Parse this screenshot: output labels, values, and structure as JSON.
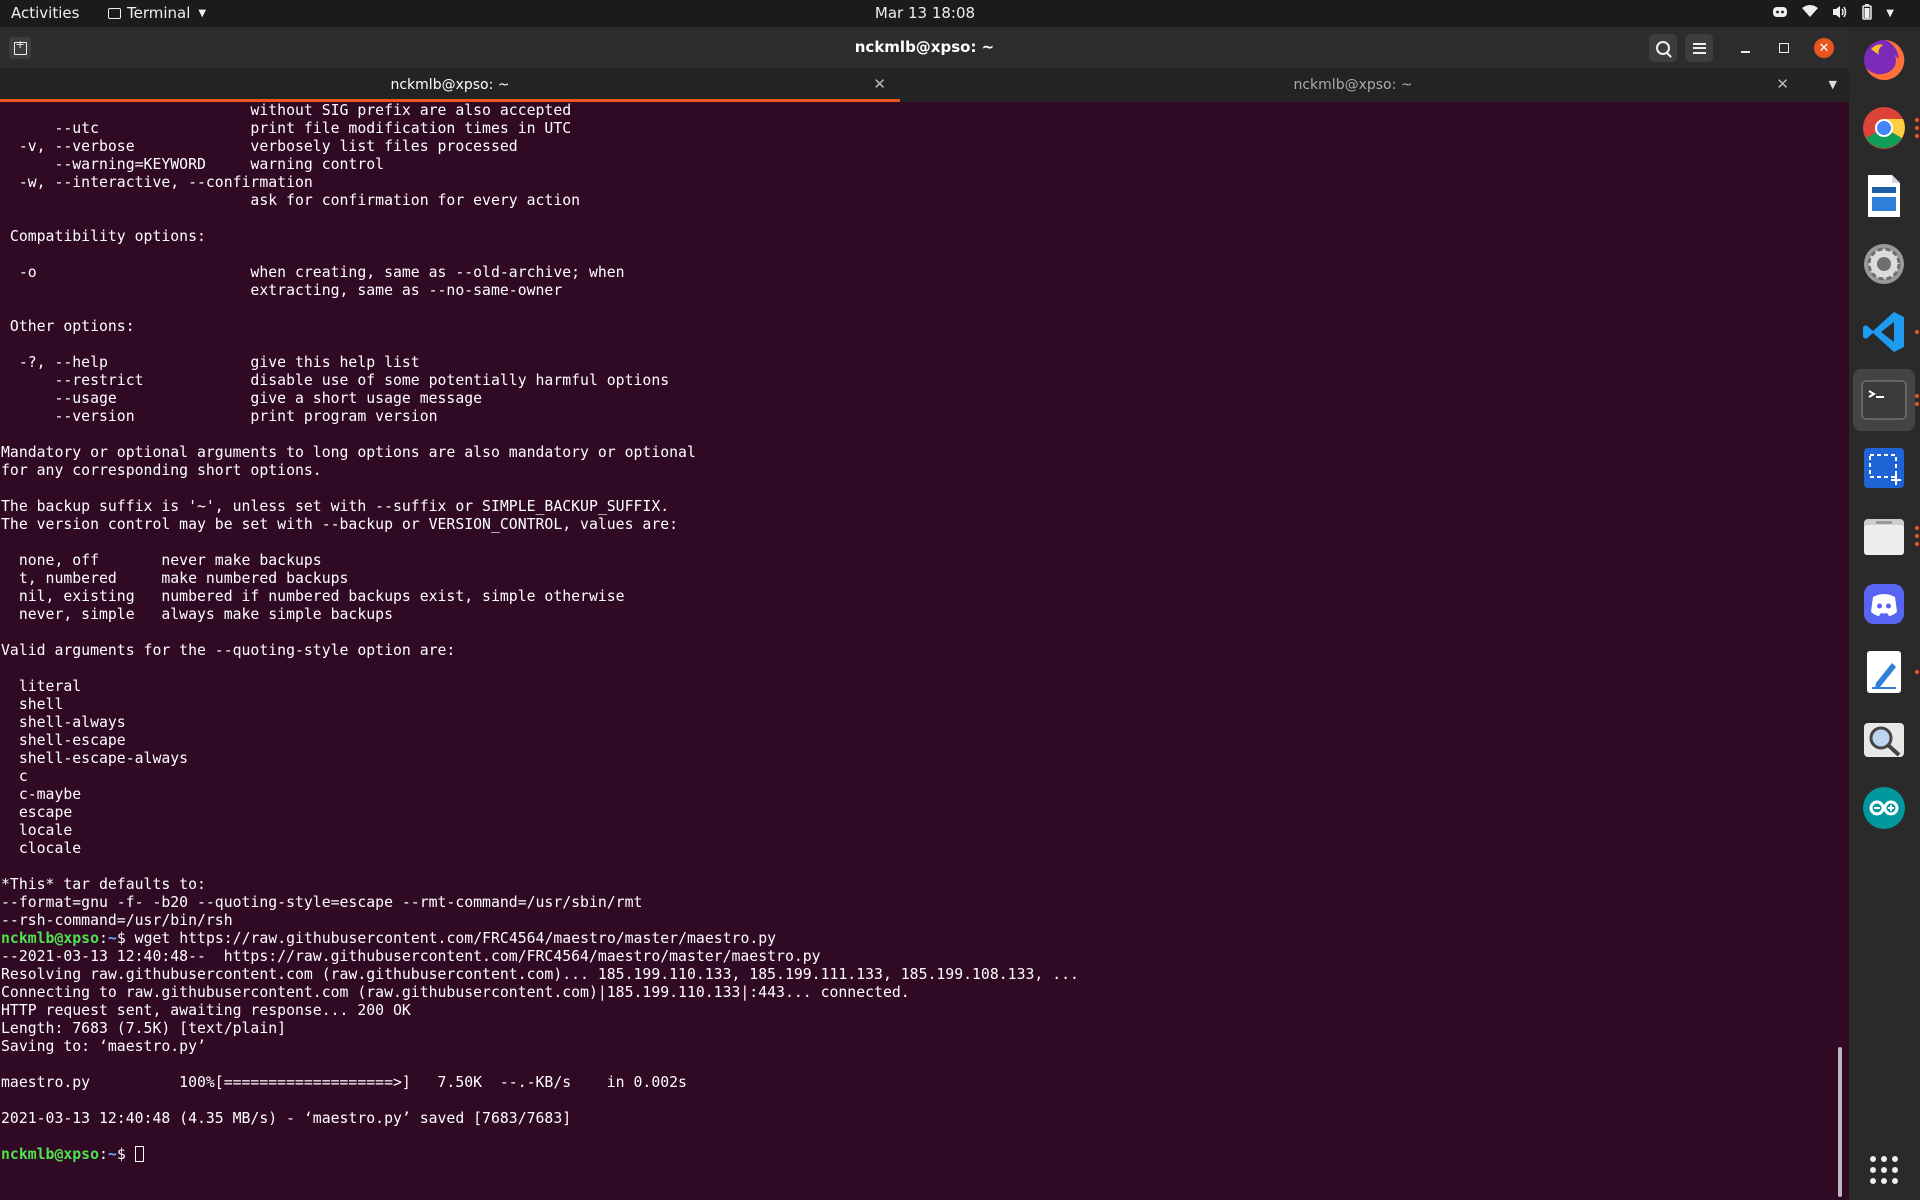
{
  "topbar": {
    "activities": "Activities",
    "app_name": "Terminal",
    "clock": "Mar 13  18:08"
  },
  "window": {
    "title": "nckmlb@xpso: ~",
    "tabs": [
      {
        "label": "nckmlb@xpso: ~",
        "active": true
      },
      {
        "label": "nckmlb@xpso: ~",
        "active": false
      }
    ]
  },
  "terminal": {
    "prompt_user": "nckmlb@xpso",
    "prompt_path": "~",
    "lines": [
      "                            without SIG prefix are also accepted",
      "      --utc                 print file modification times in UTC",
      "  -v, --verbose             verbosely list files processed",
      "      --warning=KEYWORD     warning control",
      "  -w, --interactive, --confirmation",
      "                            ask for confirmation for every action",
      "",
      " Compatibility options:",
      "",
      "  -o                        when creating, same as --old-archive; when",
      "                            extracting, same as --no-same-owner",
      "",
      " Other options:",
      "",
      "  -?, --help                give this help list",
      "      --restrict            disable use of some potentially harmful options",
      "      --usage               give a short usage message",
      "      --version             print program version",
      "",
      "Mandatory or optional arguments to long options are also mandatory or optional",
      "for any corresponding short options.",
      "",
      "The backup suffix is '~', unless set with --suffix or SIMPLE_BACKUP_SUFFIX.",
      "The version control may be set with --backup or VERSION_CONTROL, values are:",
      "",
      "  none, off       never make backups",
      "  t, numbered     make numbered backups",
      "  nil, existing   numbered if numbered backups exist, simple otherwise",
      "  never, simple   always make simple backups",
      "",
      "Valid arguments for the --quoting-style option are:",
      "",
      "  literal",
      "  shell",
      "  shell-always",
      "  shell-escape",
      "  shell-escape-always",
      "  c",
      "  c-maybe",
      "  escape",
      "  locale",
      "  clocale",
      "",
      "*This* tar defaults to:",
      "--format=gnu -f- -b20 --quoting-style=escape --rmt-command=/usr/sbin/rmt",
      "--rsh-command=/usr/bin/rsh"
    ],
    "command": "wget https://raw.githubusercontent.com/FRC4564/maestro/master/maestro.py",
    "output": [
      "--2021-03-13 12:40:48--  https://raw.githubusercontent.com/FRC4564/maestro/master/maestro.py",
      "Resolving raw.githubusercontent.com (raw.githubusercontent.com)... 185.199.110.133, 185.199.111.133, 185.199.108.133, ...",
      "Connecting to raw.githubusercontent.com (raw.githubusercontent.com)|185.199.110.133|:443... connected.",
      "HTTP request sent, awaiting response... 200 OK",
      "Length: 7683 (7.5K) [text/plain]",
      "Saving to: ‘maestro.py’",
      "",
      "maestro.py          100%[===================>]   7.50K  --.-KB/s    in 0.002s",
      "",
      "2021-03-13 12:40:48 (4.35 MB/s) - ‘maestro.py’ saved [7683/7683]",
      ""
    ]
  },
  "dock": {
    "items": [
      {
        "name": "firefox",
        "running": false
      },
      {
        "name": "chrome",
        "running": true
      },
      {
        "name": "libreoffice-impress",
        "running": false
      },
      {
        "name": "settings",
        "running": false
      },
      {
        "name": "vscode",
        "running": true
      },
      {
        "name": "terminal",
        "running": true
      },
      {
        "name": "screenshot",
        "running": false
      },
      {
        "name": "files",
        "running": true
      },
      {
        "name": "discord",
        "running": false
      },
      {
        "name": "text-editor",
        "running": true
      },
      {
        "name": "image-viewer",
        "running": false
      },
      {
        "name": "arduino",
        "running": false
      }
    ],
    "apps_grid_label": ""
  }
}
